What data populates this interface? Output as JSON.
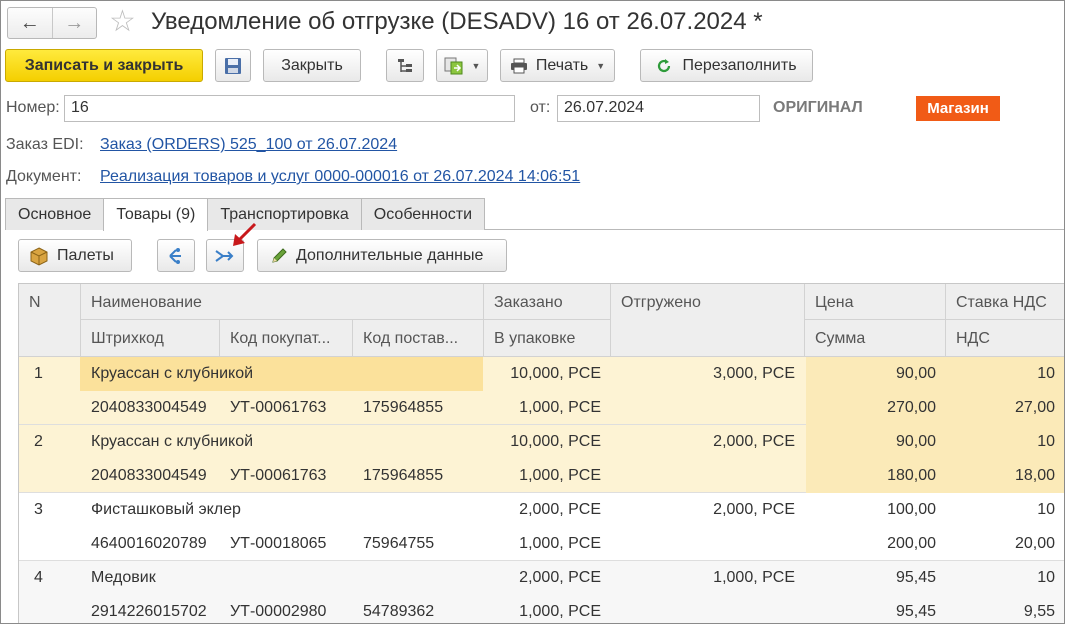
{
  "window": {
    "title": "Уведомление об отгрузке (DESADV) 16 от 26.07.2024 *",
    "back_icon": "arrow-left-icon",
    "forward_icon": "arrow-right-icon",
    "favorite_icon": "star-icon"
  },
  "toolbar": {
    "save_close": "Записать и закрыть",
    "close": "Закрыть",
    "print": "Печать",
    "refill": "Перезаполнить"
  },
  "header": {
    "number_label": "Номер:",
    "number_value": "16",
    "date_label": "от:",
    "date_value": "26.07.2024",
    "status": "ОРИГИНАЛ",
    "badge": "Магазин",
    "badge_color": "#f15b16",
    "order_label": "Заказ EDI:",
    "order_link": "Заказ (ORDERS) 525_100 от 26.07.2024",
    "doc_label": "Документ:",
    "doc_link": "Реализация товаров и услуг 0000-000016 от 26.07.2024 14:06:51"
  },
  "tabs": [
    {
      "label": "Основное"
    },
    {
      "label": "Товары (9)"
    },
    {
      "label": "Транспортировка"
    },
    {
      "label": "Особенности"
    }
  ],
  "tab_toolbar": {
    "pallets": "Палеты",
    "extra": "Дополнительные данные"
  },
  "table": {
    "headers": {
      "n": "N",
      "name": "Наименование",
      "ordered": "Заказано",
      "shipped": "Отгружено",
      "price": "Цена",
      "vat_rate": "Ставка НДС",
      "barcode": "Штрихкод",
      "buyer_code": "Код покупат...",
      "supplier_code": "Код постав...",
      "in_pack": "В упаковке",
      "sum": "Сумма",
      "vat": "НДС"
    },
    "rows": [
      {
        "n": "1",
        "name": "Круассан с клубникой",
        "ordered": "10,000, PCE",
        "shipped": "3,000, PCE",
        "price": "90,00",
        "vat_rate": "10",
        "barcode": "2040833004549",
        "buyer_code": "УТ-00061763",
        "supplier_code": "175964855",
        "in_pack": "1,000, PCE",
        "sum": "270,00",
        "vat": "27,00"
      },
      {
        "n": "2",
        "name": "Круассан с клубникой",
        "ordered": "10,000, PCE",
        "shipped": "2,000, PCE",
        "price": "90,00",
        "vat_rate": "10",
        "barcode": "2040833004549",
        "buyer_code": "УТ-00061763",
        "supplier_code": "175964855",
        "in_pack": "1,000, PCE",
        "sum": "180,00",
        "vat": "18,00"
      },
      {
        "n": "3",
        "name": "Фисташковый эклер",
        "ordered": "2,000, PCE",
        "shipped": "2,000, PCE",
        "price": "100,00",
        "vat_rate": "10",
        "barcode": "4640016020789",
        "buyer_code": "УТ-00018065",
        "supplier_code": "75964755",
        "in_pack": "1,000, PCE",
        "sum": "200,00",
        "vat": "20,00"
      },
      {
        "n": "4",
        "name": "Медовик",
        "ordered": "2,000, PCE",
        "shipped": "1,000, PCE",
        "price": "95,45",
        "vat_rate": "10",
        "barcode": "2914226015702",
        "buyer_code": "УТ-00002980",
        "supplier_code": "54789362",
        "in_pack": "1,000, PCE",
        "sum": "95,45",
        "vat": "9,55"
      }
    ]
  }
}
